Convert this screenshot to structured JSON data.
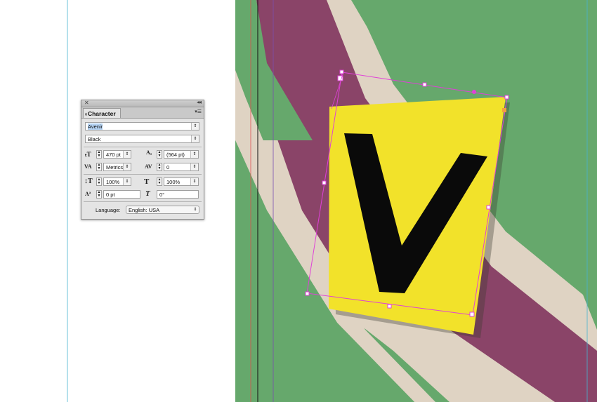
{
  "panel": {
    "title": "Character",
    "font_family": "Avenir",
    "font_style": "Black",
    "font_size": "470 pt",
    "leading": "(564 pt)",
    "kerning": "Metrics",
    "tracking": "0",
    "vertical_scale": "100%",
    "horizontal_scale": "100%",
    "baseline_shift": "0 pt",
    "skew": "0°",
    "language_label": "Language:",
    "language_value": "English: USA"
  },
  "artwork": {
    "letter": "V",
    "colors": {
      "green": "#66a86c",
      "purple": "#8a4468",
      "beige": "#dfd3c3",
      "yellow": "#f2e22a",
      "selection": "#e040d8",
      "guide_cyan": "#46b4d0",
      "guide_red": "#e05050"
    }
  }
}
